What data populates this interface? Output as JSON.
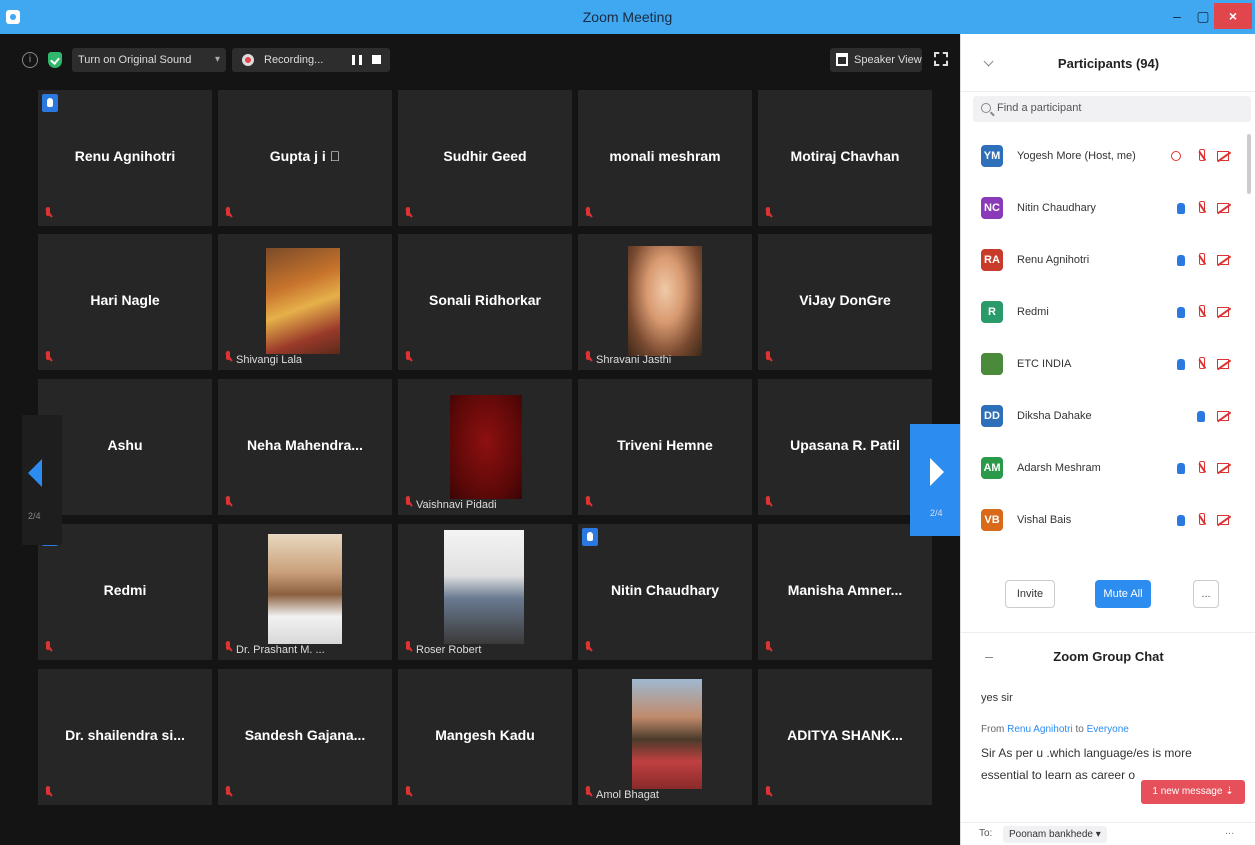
{
  "window": {
    "title": "Zoom Meeting",
    "min": "–",
    "max": "▢",
    "close": "×"
  },
  "toolbar": {
    "info": "i",
    "original_sound": "Turn on Original Sound",
    "recording": "Recording...",
    "speaker_view": "Speaker View"
  },
  "grid": {
    "tiles": [
      {
        "name": "Renu Agnihotri"
      },
      {
        "name": "Gupta j i ⃞"
      },
      {
        "name": "Sudhir Geed"
      },
      {
        "name": "monali meshram"
      },
      {
        "name": "Motiraj Chavhan"
      },
      {
        "name": "Hari Nagle"
      },
      {
        "name": "Shivangi Lala"
      },
      {
        "name": "Sonali Ridhorkar"
      },
      {
        "name": "Shravani Jasthi"
      },
      {
        "name": "ViJay DonGre"
      },
      {
        "name": "Ashu"
      },
      {
        "name": "Neha  Mahendra..."
      },
      {
        "name": "Vaishnavi Pidadi"
      },
      {
        "name": "Triveni Hemne"
      },
      {
        "name": "Upasana R. Patil"
      },
      {
        "name": "Redmi"
      },
      {
        "name": "Dr. Prashant M. ..."
      },
      {
        "name": "Roser Robert"
      },
      {
        "name": "Nitin Chaudhary"
      },
      {
        "name": "Manisha  Amner..."
      },
      {
        "name": "Dr. shailendra si..."
      },
      {
        "name": "Sandesh  Gajana..."
      },
      {
        "name": "Mangesh Kadu"
      },
      {
        "name": "Amol Bhagat"
      },
      {
        "name": "ADITYA  SHANK..."
      }
    ],
    "page_left": "2/4",
    "page_right": "2/4"
  },
  "participants": {
    "title": "Participants (94)",
    "search_placeholder": "Find a participant",
    "list": [
      {
        "initials": "YM",
        "name": "Yogesh More (Host, me)",
        "color": "#2d6fb8"
      },
      {
        "initials": "NC",
        "name": "Nitin Chaudhary",
        "color": "#8a3ab8"
      },
      {
        "initials": "RA",
        "name": "Renu Agnihotri",
        "color": "#c83a2a"
      },
      {
        "initials": "R",
        "name": "Redmi",
        "color": "#2a9a6a"
      },
      {
        "initials": "",
        "name": "ETC INDIA",
        "color": "#4a8a3a"
      },
      {
        "initials": "DD",
        "name": "Diksha Dahake",
        "color": "#2d6fb8"
      },
      {
        "initials": "AM",
        "name": "Adarsh Meshram",
        "color": "#2a9a4a"
      },
      {
        "initials": "VB",
        "name": "Vishal Bais",
        "color": "#d86a1a"
      }
    ],
    "invite": "Invite",
    "mute_all": "Mute All",
    "more": "..."
  },
  "chat": {
    "title": "Zoom Group Chat",
    "msg1": "yes sir",
    "from_prefix": "From ",
    "from_name": "Renu Agnihotri",
    "to_word": " to ",
    "to_name": "Everyone",
    "msg2": "Sir As per u .which language/es is more essential to learn as career o",
    "new_message": "1 new message ⇣",
    "to_label": "To:",
    "recipient": "Poonam bankhede ▾",
    "input_more": "..."
  }
}
